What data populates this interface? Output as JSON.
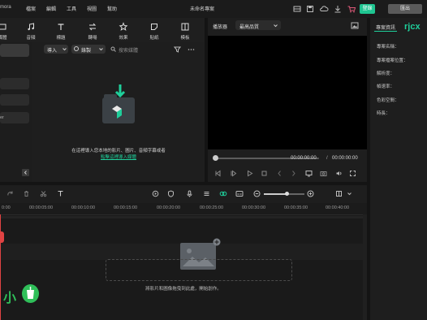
{
  "app": {
    "name_fragment": "mora",
    "project_title": "未命名專案"
  },
  "menu": [
    "檔案",
    "編輯",
    "工具",
    "視圖",
    "幫助"
  ],
  "topbar": {
    "login_label": "登錄",
    "export_label": "匯出"
  },
  "toolbar": [
    {
      "label": "媒體",
      "icon": "media-icon"
    },
    {
      "label": "音頻",
      "icon": "music-icon"
    },
    {
      "label": "標題",
      "icon": "title-icon"
    },
    {
      "label": "轉場",
      "icon": "transition-icon"
    },
    {
      "label": "效果",
      "icon": "effects-icon"
    },
    {
      "label": "貼紙",
      "icon": "sticker-icon"
    },
    {
      "label": "模板",
      "icon": "template-icon"
    }
  ],
  "left_nav": {
    "items": [
      "",
      "",
      "",
      "er"
    ]
  },
  "media": {
    "import_label": "導入",
    "record_label": "錄製",
    "search_placeholder": "搜索媒體",
    "empty_text": "在這裡導入您本地的影片、圖片、音頻字幕或者",
    "empty_link": "點擊這裡導入媒體"
  },
  "player": {
    "tab_label": "播放器",
    "quality_label": "最高品質",
    "current_time": "00:00:00:00",
    "separator": "/",
    "total_time": "00:00:00:00"
  },
  "properties": {
    "tab_label": "專案資訊",
    "rows": [
      "專案名稱：",
      "專案檔案位置：",
      "解析度：",
      "幀速率：",
      "色彩空間：",
      "時長："
    ]
  },
  "timeline": {
    "ruler": [
      "0:00",
      "00:00:05:00",
      "00:00:10:00",
      "00:00:15:00",
      "00:00:20:00",
      "00:00:25:00",
      "00:00:30:00",
      "00:00:35:00",
      "00:00:40:00"
    ],
    "drop_text": "將影片和圖像拖曳到此處，開始創作。"
  },
  "watermark": {
    "top_right": "rjcx",
    "bottom_left": "小"
  },
  "colors": {
    "accent": "#1fcf9b",
    "login": "#1fc591",
    "playhead": "#e04343"
  }
}
